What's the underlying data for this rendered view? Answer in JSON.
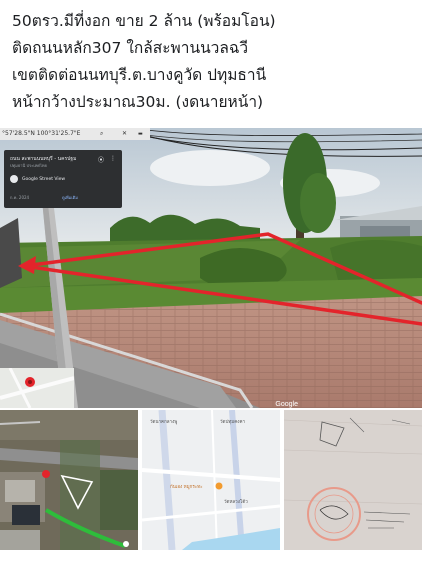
{
  "post": {
    "lines": [
      "50ตรว.มีที่งอก ขาย 2 ล้าน (พร้อมโอน)",
      "ติดถนนหลัก307 ใกล้สะพานนวลฉวี",
      "เขตติดต่อนนทบุรี.ต.บางคูวัด ปทุมธานี",
      "หน้ากว้างประมาณ30ม. (งดนายหน้า)"
    ]
  },
  "street_view": {
    "coords": "°57'28.5\"N 100°31'25.7\"E",
    "place_title": "ถนน สะพานนนทบุรี - นครปฐม",
    "place_sub": "ปทุมธานี ประเทศไทย",
    "source": "Google Street View",
    "date": "ก.ค. 2024",
    "more": "ดูเพิ่มเติม",
    "watermark": "Google"
  },
  "map_thumb": {
    "label_top_left": "วัดนาคกลางพู",
    "label_top_right": "วัดปทุมคงคา",
    "label_mid": "กันเอง หมูกระทะ",
    "label_right": "วัดหลวงโต้ว"
  },
  "colors": {
    "text": "#1c1e21",
    "marker_red": "#e3242b",
    "grass": "#4e7a2c",
    "sky": "#cfd8e0"
  }
}
